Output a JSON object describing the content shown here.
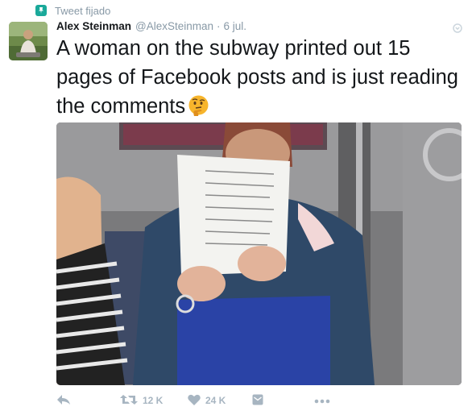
{
  "pinned": {
    "label": "Tweet fijado",
    "icon": "pin-icon"
  },
  "author": {
    "name": "Alex Steinman",
    "handle": "@AlexSteinman",
    "separator": "·",
    "date": "6 jul."
  },
  "tweet": {
    "text": "A woman on the subway printed out 15 pages of Facebook posts and is just reading the comments",
    "emoji": "thinking-face-emoji"
  },
  "actions": {
    "reply": {
      "icon": "reply-icon"
    },
    "retweet": {
      "icon": "retweet-icon",
      "count": "12 K"
    },
    "like": {
      "icon": "heart-icon",
      "count": "24 K"
    },
    "dm": {
      "icon": "message-icon"
    },
    "more": {
      "icon": "more-icon"
    }
  },
  "colors": {
    "accent": "#1aa99a",
    "muted": "#8899a6",
    "action_icon": "#a7b5c1",
    "text": "#14171a"
  }
}
